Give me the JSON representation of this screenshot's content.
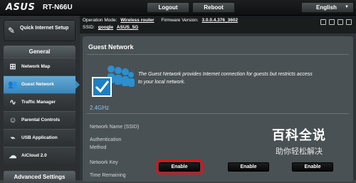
{
  "header": {
    "brand": "ASUS",
    "model": "RT-N66U",
    "buttons": {
      "logout": "Logout",
      "reboot": "Reboot"
    },
    "language": "English"
  },
  "info": {
    "operation_mode_label": "Operation Mode:",
    "operation_mode_value": "Wireless router",
    "firmware_label": "Firmware Version:",
    "firmware_value": "3.0.0.4.376_3602",
    "ssid_label": "SSID:",
    "ssid_values": [
      "google",
      "ASUS_5G"
    ]
  },
  "sidebar": {
    "quick_setup": "Quick Internet Setup",
    "general_title": "General",
    "items": [
      {
        "label": "Network Map",
        "icon": "network-map-icon"
      },
      {
        "label": "Guest Network",
        "icon": "guest-network-icon",
        "active": true
      },
      {
        "label": "Traffic Manager",
        "icon": "traffic-manager-icon"
      },
      {
        "label": "Parental Controls",
        "icon": "parental-controls-icon"
      },
      {
        "label": "USB Application",
        "icon": "usb-icon"
      },
      {
        "label": "AiCloud 2.0",
        "icon": "cloud-icon"
      }
    ],
    "advanced_title": "Advanced Settings"
  },
  "main": {
    "title": "Guest Network",
    "description": "The Guest Network provides Internet connection for guests but restricts access to your local network.",
    "band": "2.4GHz",
    "rows": [
      "Network Name (SSID)",
      "Authentication Method",
      "Network Key",
      "Time Remaining"
    ],
    "enable_buttons": [
      "Enable",
      "Enable",
      "Enable"
    ]
  },
  "watermark": {
    "big": "百科全说",
    "small": "助你轻松解决"
  },
  "colors": {
    "accent": "#3b86b8",
    "band_text": "#8fc6ea",
    "highlight": "#d8141f"
  }
}
